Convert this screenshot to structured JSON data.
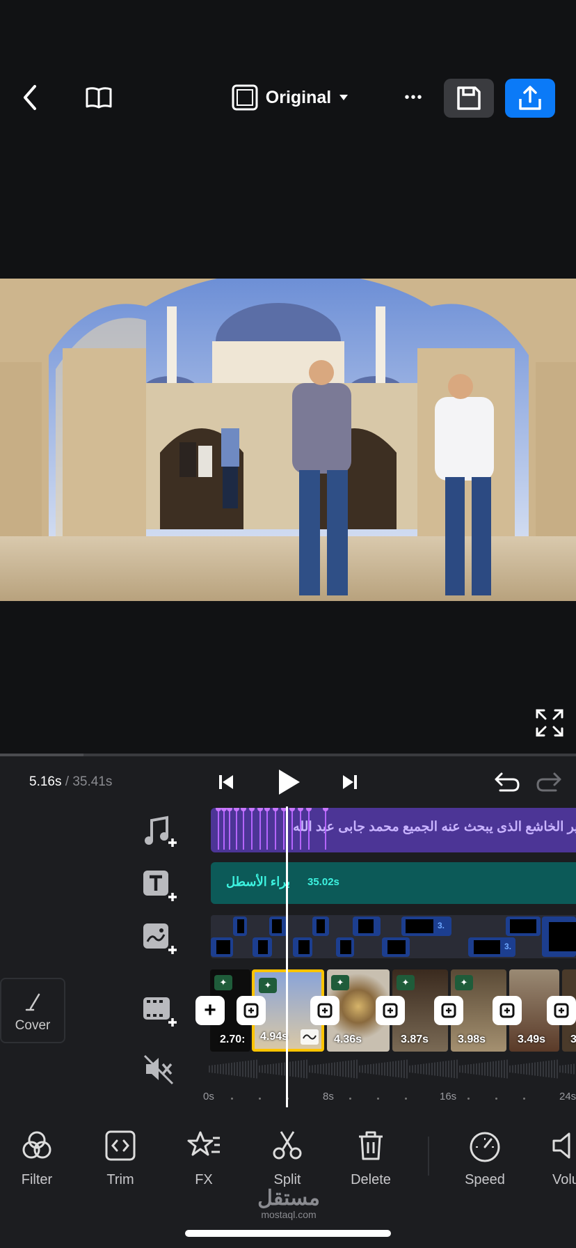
{
  "topbar": {
    "ratio_label": "Original",
    "more_label": "•••",
    "icons": [
      "chevron-left-icon",
      "book-icon",
      "aspect-ratio-icon",
      "caret-down-icon",
      "more-icon",
      "save-icon",
      "export-icon"
    ]
  },
  "playback": {
    "current_time": "5.16s",
    "separator": " / ",
    "total_time": "35.41s"
  },
  "tracks": {
    "music": {
      "text": "بهير الخاشع الذى يبحث عنه الجميع  محمد جابى عبد الله"
    },
    "text": {
      "label": "براء الأسطل",
      "duration": "35.02s"
    },
    "overlay": {
      "badges": [
        "3.",
        "3."
      ]
    },
    "video": {
      "add_label": "+",
      "clips": [
        {
          "duration": "2.70:"
        },
        {
          "duration": "4.94s"
        },
        {
          "duration": "4.36s"
        },
        {
          "duration": "3.87s"
        },
        {
          "duration": "3.98s"
        },
        {
          "duration": "3.49s"
        },
        {
          "duration": "3"
        }
      ]
    }
  },
  "cover": {
    "label": "Cover"
  },
  "ruler": {
    "ticks": [
      "0s",
      "8s",
      "16s",
      "24s"
    ]
  },
  "toolbar": {
    "items": [
      {
        "label": "Filter"
      },
      {
        "label": "Trim"
      },
      {
        "label": "FX"
      },
      {
        "label": "Split"
      },
      {
        "label": "Delete"
      },
      {
        "label": "Speed"
      },
      {
        "label": "Volu"
      }
    ]
  },
  "watermark": {
    "arabic": "مستقل",
    "latin": "mostaql.com"
  },
  "colors": {
    "accent": "#0b7af7",
    "music_track": "#4c3596",
    "text_track": "#0c5a58",
    "selection": "#ffc400"
  }
}
